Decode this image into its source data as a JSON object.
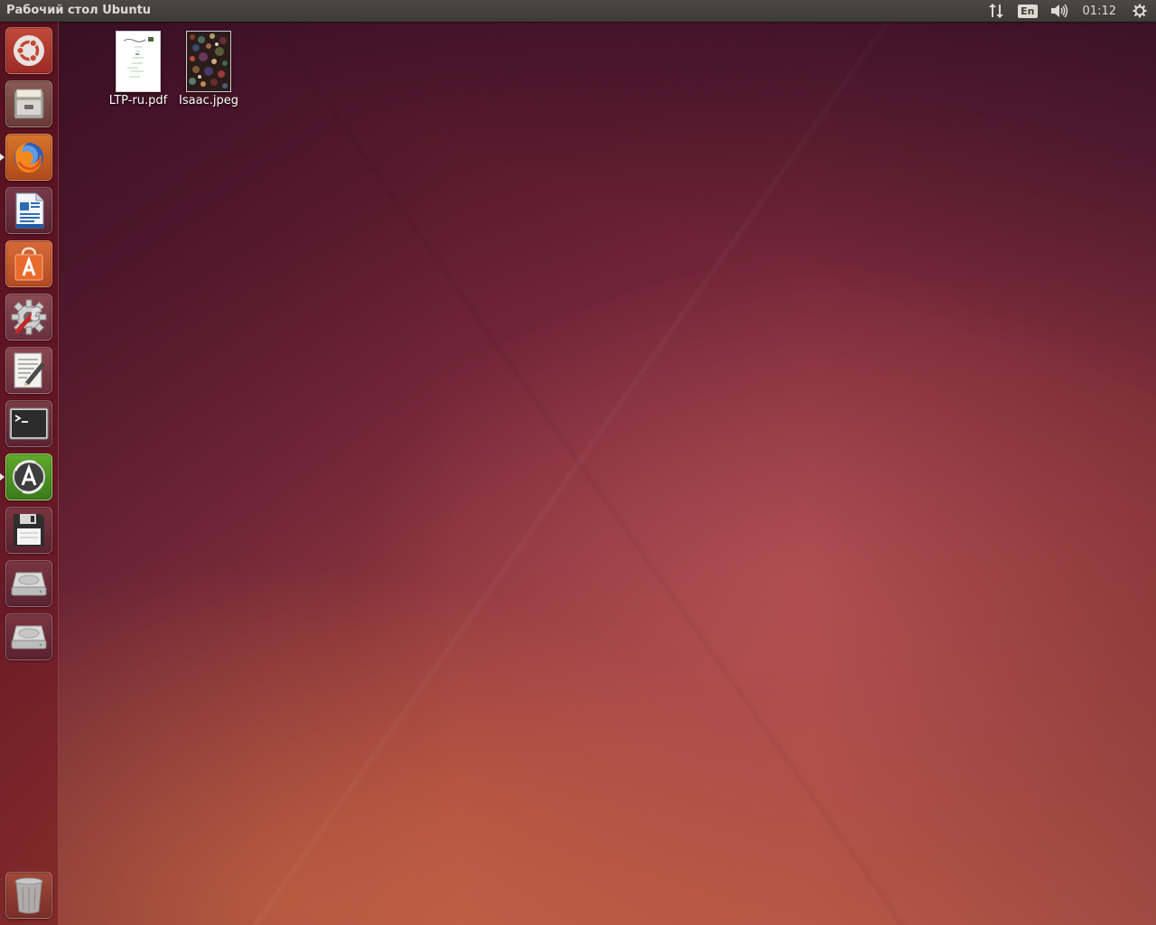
{
  "top_panel": {
    "title": "Рабочий стол Ubuntu",
    "keyboard_layout": "En",
    "clock": "01:12",
    "icons": [
      "network-transfer-icon",
      "keyboard-layout-indicator",
      "volume-icon",
      "clock",
      "system-gear-icon"
    ]
  },
  "launcher": {
    "items": [
      {
        "name": "dash-home",
        "icon": "ubuntu-logo-icon"
      },
      {
        "name": "files",
        "icon": "file-cabinet-icon"
      },
      {
        "name": "firefox",
        "icon": "firefox-icon"
      },
      {
        "name": "libreoffice-writer",
        "icon": "writer-document-icon"
      },
      {
        "name": "ubuntu-software-center",
        "icon": "shopping-bag-icon"
      },
      {
        "name": "system-settings",
        "icon": "settings-wrench-gear-icon"
      },
      {
        "name": "text-editor",
        "icon": "text-editor-icon"
      },
      {
        "name": "terminal",
        "icon": "terminal-icon"
      },
      {
        "name": "software-updater",
        "icon": "software-updater-icon"
      },
      {
        "name": "floppy-drive",
        "icon": "floppy-disk-icon"
      },
      {
        "name": "hard-drive-1",
        "icon": "hard-drive-icon"
      },
      {
        "name": "hard-drive-2",
        "icon": "hard-drive-icon"
      },
      {
        "name": "trash",
        "icon": "trash-icon"
      }
    ]
  },
  "desktop": {
    "icons": [
      {
        "label": "LTP-ru.pdf",
        "type": "pdf-document-thumbnail"
      },
      {
        "label": "Isaac.jpeg",
        "type": "image-thumbnail"
      }
    ]
  },
  "colors": {
    "panel_bg": "#3c3b37",
    "panel_text": "#dfdbd2",
    "launcher_tint": "#6e141e",
    "ubuntu_orange": "#dd4814"
  }
}
